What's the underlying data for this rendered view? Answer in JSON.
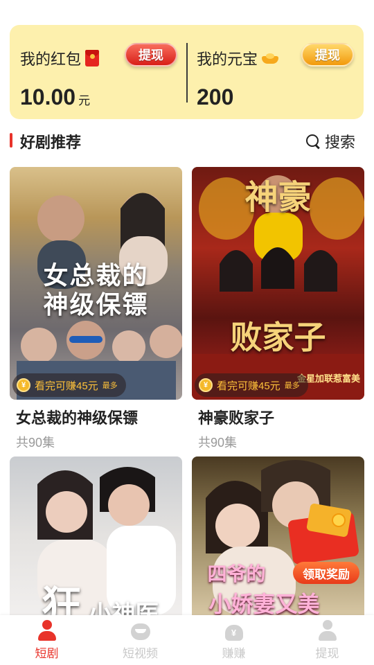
{
  "wallet": {
    "red_packet": {
      "title": "我的红包",
      "button": "提现",
      "amount": "10.00",
      "unit": "元"
    },
    "ingot": {
      "title": "我的元宝",
      "button": "提现",
      "amount": "200"
    }
  },
  "section": {
    "title": "好剧推荐",
    "search_label": "搜索"
  },
  "dramas": [
    {
      "poster_title_line1": "女总裁的",
      "poster_title_line2": "神级保镖",
      "earn": "看完可赚45元",
      "earn_suffix": "最多",
      "title": "女总裁的神级保镖",
      "episodes": "共90集"
    },
    {
      "poster_title_line1": "神豪",
      "poster_title_line2": "败家子",
      "poster_extra": "金星加联惹富美",
      "earn": "看完可赚45元",
      "earn_suffix": "最多",
      "title": "神豪败家子",
      "episodes": "共90集"
    },
    {
      "poster_title_line1": "狂",
      "poster_title_line2": "小神医"
    },
    {
      "poster_title_line1": "四爷的",
      "poster_title_line2": "小娇妻又美",
      "promo_label": "领取奖励"
    }
  ],
  "nav": [
    {
      "label": "短剧",
      "icon": "drama-person-icon",
      "active": true
    },
    {
      "label": "短视频",
      "icon": "tv-icon",
      "active": false
    },
    {
      "label": "赚赚",
      "icon": "money-bag-icon",
      "active": false
    },
    {
      "label": "提现",
      "icon": "user-icon",
      "active": false
    }
  ],
  "colors": {
    "accent": "#e8332a",
    "wallet_bg": "#fdf0ad",
    "earn_text": "#ffc23a",
    "inactive_nav": "#c8c8c8"
  }
}
